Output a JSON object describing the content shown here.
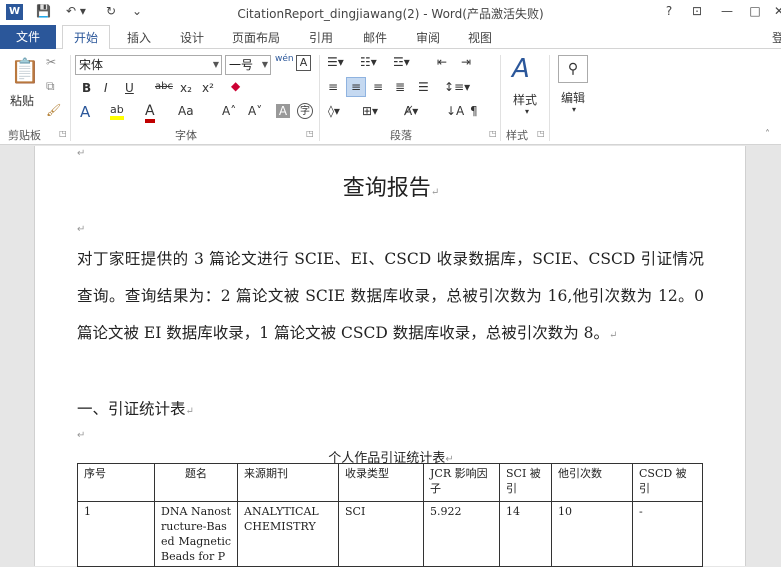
{
  "window": {
    "title": "CitationReport_dingjiawang(2) - Word(产品激活失败)",
    "help": "?",
    "minimize": "—",
    "restore": "□",
    "close": "✕",
    "signin_partial": "登"
  },
  "tabs": {
    "file": "文件",
    "items": [
      "开始",
      "插入",
      "设计",
      "页面布局",
      "引用",
      "邮件",
      "审阅",
      "视图"
    ]
  },
  "ribbon": {
    "clipboard": {
      "paste": "粘贴",
      "label": "剪贴板"
    },
    "font": {
      "name": "宋体",
      "size": "一号",
      "wen": "wén",
      "bold": "B",
      "italic": "I",
      "underline": "U",
      "strike": "abc",
      "sub": "x₂",
      "sup": "x²",
      "grow": "A˄",
      "shrink": "A˅",
      "case": "Aa",
      "label": "字体"
    },
    "paragraph": {
      "label": "段落"
    },
    "styles": {
      "button": "样式",
      "label": "样式"
    },
    "editing": {
      "button": "编辑"
    }
  },
  "document": {
    "heading": "查询报告",
    "body": "对丁家旺提供的 3 篇论文进行 SCIE、EI、CSCD 收录数据库，SCIE、CSCD 引证情况查询。查询结果为：2 篇论文被 SCIE 数据库收录，总被引次数为 16,他引次数为 12。0 篇论文被 EI 数据库收录，1 篇论文被 CSCD 数据库收录，总被引次数为 8。",
    "section": "一、引证统计表",
    "table_caption": "个人作品引证统计表",
    "table": {
      "headers": [
        "序号",
        "题名",
        "来源期刊",
        "收录类型",
        "JCR 影响因子",
        "SCI 被引",
        "他引次数",
        "CSCD 被引"
      ],
      "rows": [
        [
          "1",
          "DNA Nanostructure-Based Magnetic Beads for P",
          "ANALYTICAL CHEMISTRY",
          "SCI",
          "5.922",
          "14",
          "10",
          "-"
        ]
      ]
    }
  }
}
